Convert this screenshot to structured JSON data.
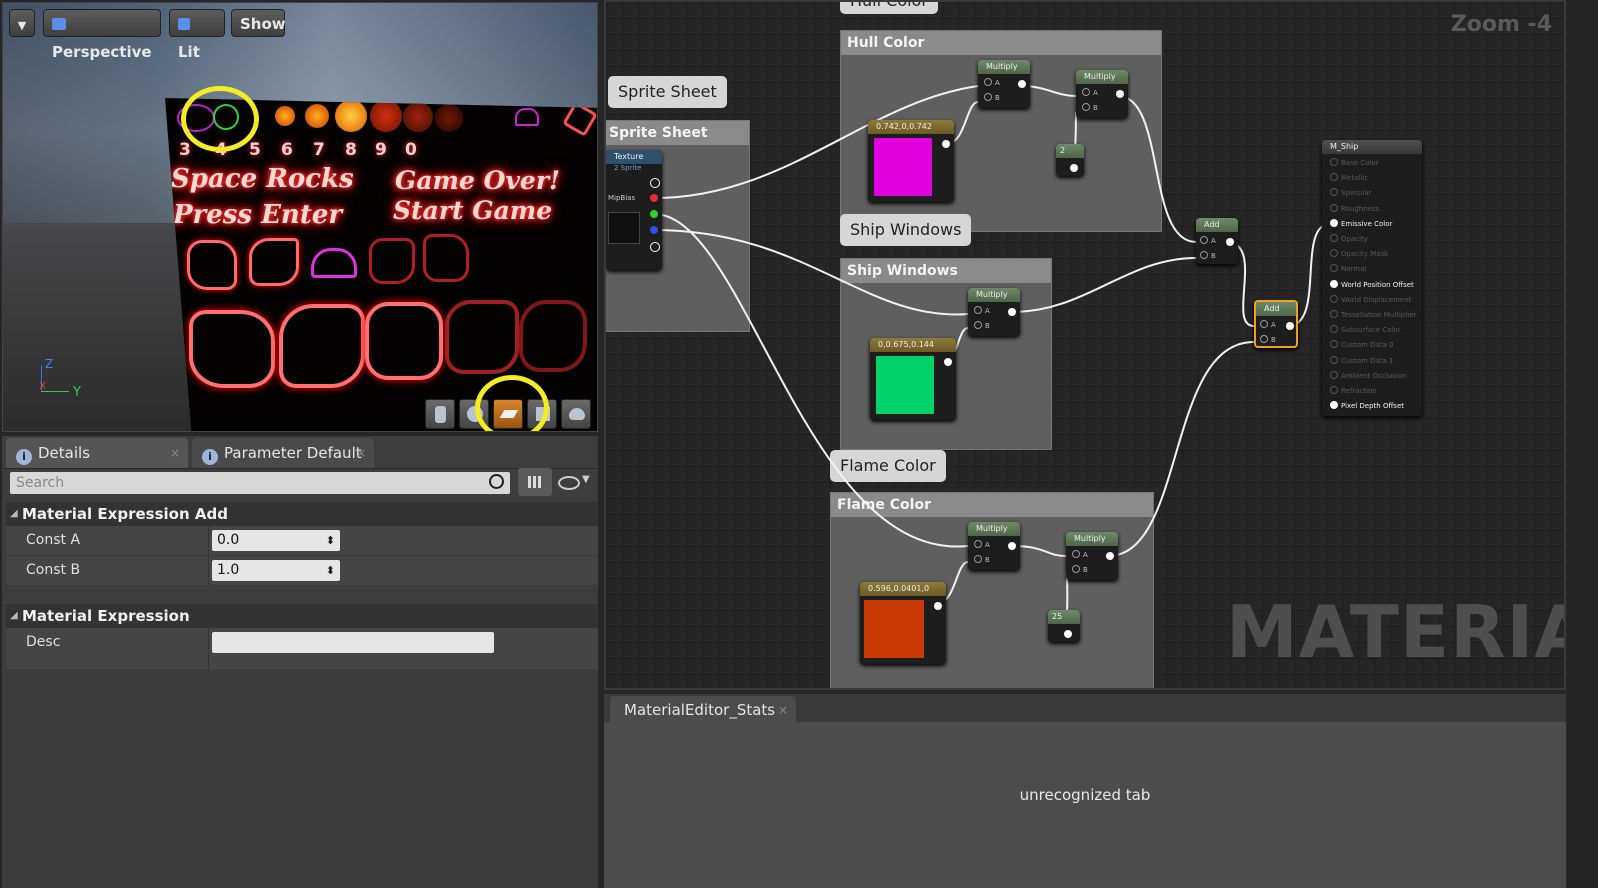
{
  "viewport": {
    "perspective_label": "Perspective",
    "lit_label": "Lit",
    "show_label": "Show",
    "preview_numbers": [
      "3",
      "4",
      "5",
      "6",
      "7",
      "8",
      "9",
      "0"
    ],
    "sprite_text": [
      "Space Rocks",
      "Game Over!",
      "Press Enter",
      "Start Game"
    ],
    "axis": {
      "z": "Z",
      "x": "X",
      "y": "Y"
    }
  },
  "details": {
    "tabs": [
      {
        "label": "Details"
      },
      {
        "label": "Parameter Default"
      }
    ],
    "search_placeholder": "Search",
    "sections": [
      {
        "title": "Material Expression Add",
        "rows": [
          {
            "label": "Const A",
            "value": "0.0"
          },
          {
            "label": "Const B",
            "value": "1.0"
          }
        ]
      },
      {
        "title": "Material Expression",
        "rows": [
          {
            "label": "Desc",
            "value": ""
          }
        ]
      }
    ]
  },
  "graph": {
    "zoom_label": "Zoom -4",
    "watermark": "MATERIAL",
    "bubbles": {
      "hull_top": "Hull Color",
      "sprite": "Sprite Sheet",
      "ship_windows": "Ship Windows",
      "flame": "Flame Color"
    },
    "comments": {
      "sprite": "Sprite Sheet",
      "hull": "Hull Color",
      "windows": "Ship Windows",
      "flame": "Flame Color"
    },
    "texture_node": {
      "title": "Texture",
      "subtitle": "2 Sprite",
      "mip_label": "MipBias"
    },
    "nodes": {
      "multiply": "Multiply",
      "add": "Add",
      "pin_a": "A",
      "pin_b": "B",
      "hull_const": "0.742,0,0.742",
      "windows_const": "0,0.675,0.144",
      "flame_const": "0.596,0.0401,0",
      "hull_scalar": "2",
      "flame_scalar": "25"
    },
    "result_node": {
      "title": "M_Ship",
      "pins": [
        "Base Color",
        "Metallic",
        "Specular",
        "Roughness",
        "Emissive Color",
        "Opacity",
        "Opacity Mask",
        "Normal",
        "World Position Offset",
        "World Displacement",
        "Tessellation Multiplier",
        "Subsurface Color",
        "Custom Data 0",
        "Custom Data 1",
        "Ambient Occlusion",
        "Refraction",
        "Pixel Depth Offset"
      ],
      "active": [
        "Emissive Color",
        "World Position Offset",
        "Pixel Depth Offset"
      ]
    },
    "colors": {
      "hull": "#e000e0",
      "windows": "#00d26a",
      "flame": "#c93a06",
      "highlight": "#f0a020"
    }
  },
  "stats": {
    "tab_label": "MaterialEditor_Stats",
    "message": "unrecognized tab"
  }
}
